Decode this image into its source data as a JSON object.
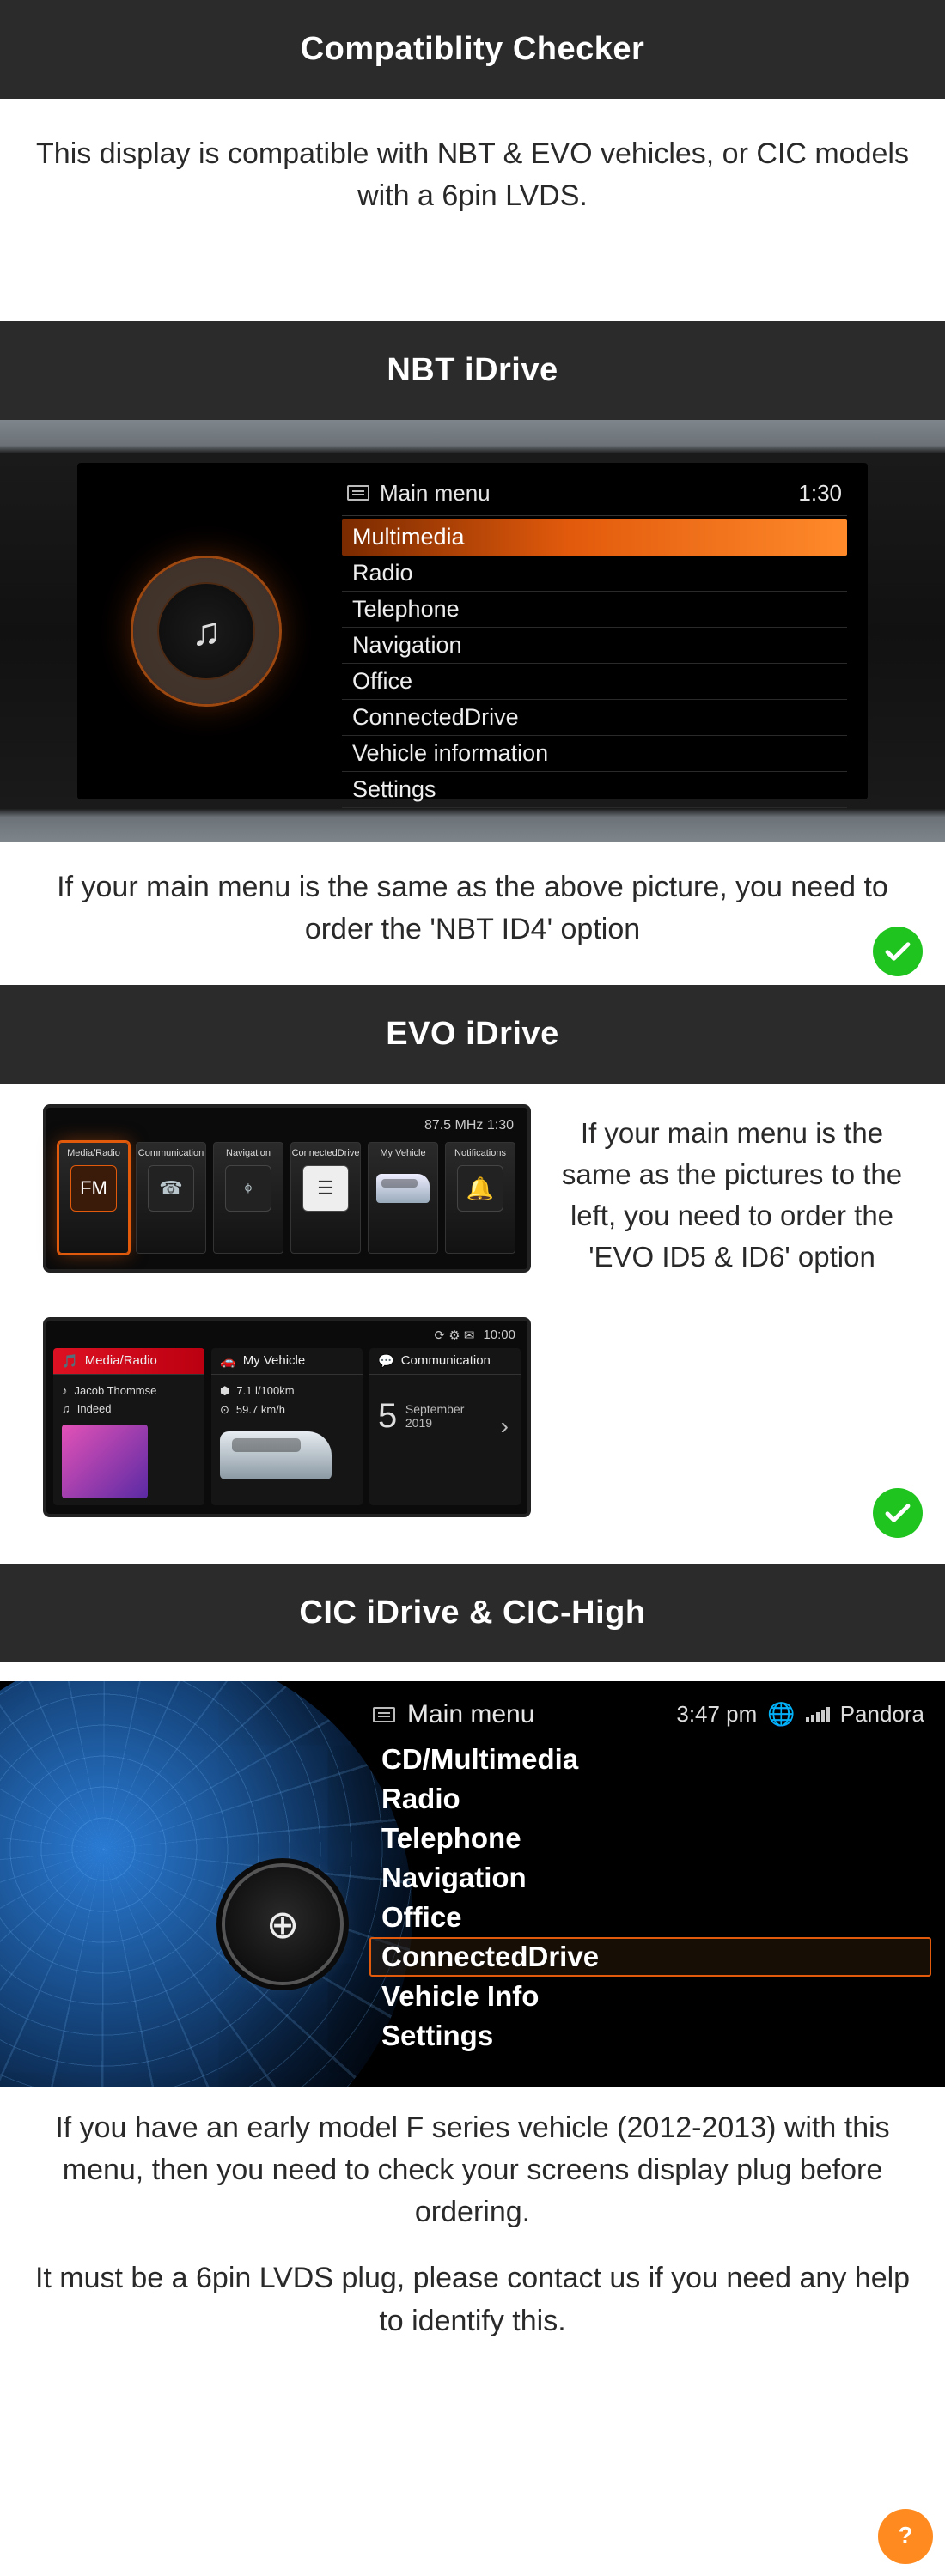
{
  "headers": {
    "main": "Compatiblity Checker",
    "nbt": "NBT iDrive",
    "evo": "EVO iDrive",
    "cic": "CIC iDrive & CIC-High"
  },
  "intro": "This display is compatible with NBT & EVO vehicles, or CIC models with a 6pin LVDS.",
  "nbt": {
    "menu_title": "Main menu",
    "clock": "1:30",
    "dial_glyph": "♫",
    "items": [
      "Multimedia",
      "Radio",
      "Telephone",
      "Navigation",
      "Office",
      "ConnectedDrive",
      "Vehicle information",
      "Settings"
    ],
    "selected_index": 0,
    "caption": "If your main menu is the same as the above picture, you need to order the 'NBT ID4' option"
  },
  "evo": {
    "top_status": "87.5 MHz  1:30",
    "tiles": [
      {
        "label": "Media/Radio",
        "glyph": "FM",
        "sel": true
      },
      {
        "label": "Communication",
        "glyph": "☎"
      },
      {
        "label": "Navigation",
        "glyph": "⌖"
      },
      {
        "label": "ConnectedDrive",
        "glyph": "☰",
        "white": true
      },
      {
        "label": "My Vehicle",
        "car": true
      },
      {
        "label": "Notifications",
        "bell": true,
        "glyph": "🔔"
      }
    ],
    "caption": "If your main menu is the same as the pictures to the left, you need to order the 'EVO ID5 & ID6' option",
    "shot2": {
      "status": {
        "icons": "⟳ ⚙ ✉",
        "time": "10:00"
      },
      "col1": {
        "title": "Media/Radio",
        "line1_icon": "♪",
        "line1": "Jacob Thommse",
        "line2_icon": "♫",
        "line2": "Indeed"
      },
      "col2": {
        "title": "My Vehicle",
        "line1_icon": "⬢",
        "line1": "7.1 l/100km",
        "line2_icon": "⊙",
        "line2": "59.7 km/h"
      },
      "col3": {
        "title": "Communication",
        "date_big": "5",
        "date_month": "September",
        "date_year": "2019"
      }
    }
  },
  "cic": {
    "menu_title": "Main menu",
    "clock": "3:47 pm",
    "provider": "Pandora",
    "dial_glyph": "⊕",
    "items": [
      "CD/Multimedia",
      "Radio",
      "Telephone",
      "Navigation",
      "Office",
      "ConnectedDrive",
      "Vehicle Info",
      "Settings"
    ],
    "selected_index": 5,
    "caption1": "If you have an early model F series vehicle (2012-2013)  with this menu, then you need to check your screens display plug before ordering.",
    "caption2": "It must be a 6pin LVDS plug, please contact us if you need any help to identify this."
  },
  "icons": {
    "check": "check",
    "help": "?"
  }
}
